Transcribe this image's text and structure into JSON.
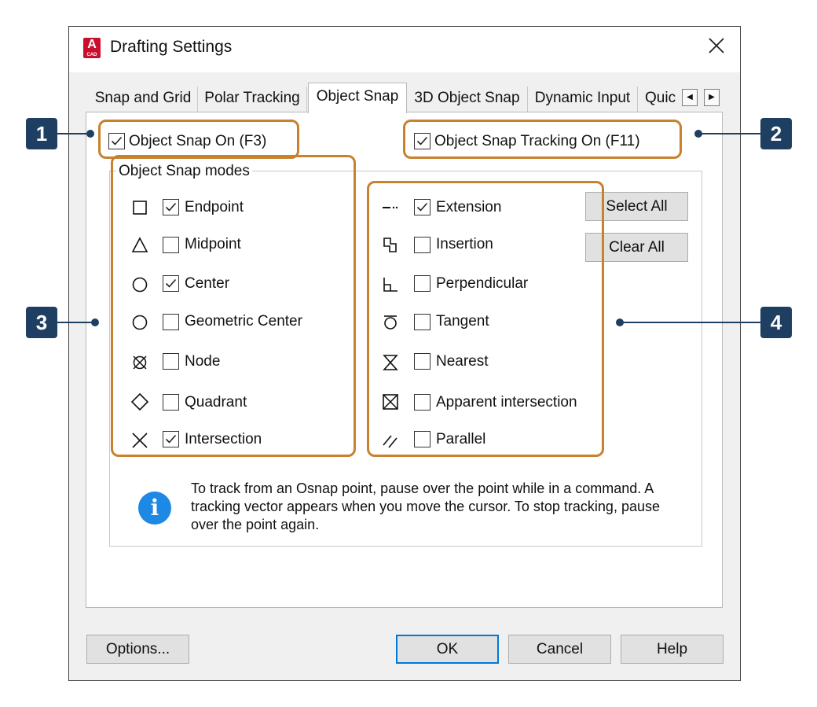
{
  "window": {
    "title": "Drafting Settings",
    "app_icon_letter": "A",
    "app_icon_sub": "CAD"
  },
  "tabs": [
    "Snap and Grid",
    "Polar Tracking",
    "Object Snap",
    "3D Object Snap",
    "Dynamic Input",
    "Quic"
  ],
  "active_tab": "Object Snap",
  "object_snap_on": {
    "label": "Object Snap On (F3)",
    "checked": true
  },
  "object_snap_tracking_on": {
    "label": "Object Snap Tracking On (F11)",
    "checked": true
  },
  "modes_group_title": "Object Snap modes",
  "left_modes": [
    {
      "label": "Endpoint",
      "checked": true,
      "icon": "endpoint-square-icon"
    },
    {
      "label": "Midpoint",
      "checked": false,
      "icon": "midpoint-triangle-icon"
    },
    {
      "label": "Center",
      "checked": true,
      "icon": "center-circle-icon"
    },
    {
      "label": "Geometric Center",
      "checked": false,
      "icon": "geometric-center-icon"
    },
    {
      "label": "Node",
      "checked": false,
      "icon": "node-icon"
    },
    {
      "label": "Quadrant",
      "checked": false,
      "icon": "quadrant-diamond-icon"
    },
    {
      "label": "Intersection",
      "checked": true,
      "icon": "intersection-x-icon"
    }
  ],
  "right_modes": [
    {
      "label": "Extension",
      "checked": true,
      "icon": "extension-icon"
    },
    {
      "label": "Insertion",
      "checked": false,
      "icon": "insertion-icon"
    },
    {
      "label": "Perpendicular",
      "checked": false,
      "icon": "perpendicular-icon"
    },
    {
      "label": "Tangent",
      "checked": false,
      "icon": "tangent-icon"
    },
    {
      "label": "Nearest",
      "checked": false,
      "icon": "nearest-icon"
    },
    {
      "label": "Apparent intersection",
      "checked": false,
      "icon": "apparent-intersection-icon"
    },
    {
      "label": "Parallel",
      "checked": false,
      "icon": "parallel-icon"
    }
  ],
  "buttons": {
    "select_all": "Select All",
    "clear_all": "Clear All",
    "options": "Options...",
    "ok": "OK",
    "cancel": "Cancel",
    "help": "Help"
  },
  "info": {
    "text": "To track from an Osnap point, pause over the point while in a command.  A tracking vector appears when you move the cursor.  To stop tracking, pause over the point again."
  },
  "callouts": [
    "1",
    "2",
    "3",
    "4"
  ],
  "colors": {
    "highlight": "#c8812f",
    "callout": "#1f3f62",
    "info": "#1e88e5",
    "app_icon": "#c8102e",
    "default_button": "#0078d7"
  }
}
